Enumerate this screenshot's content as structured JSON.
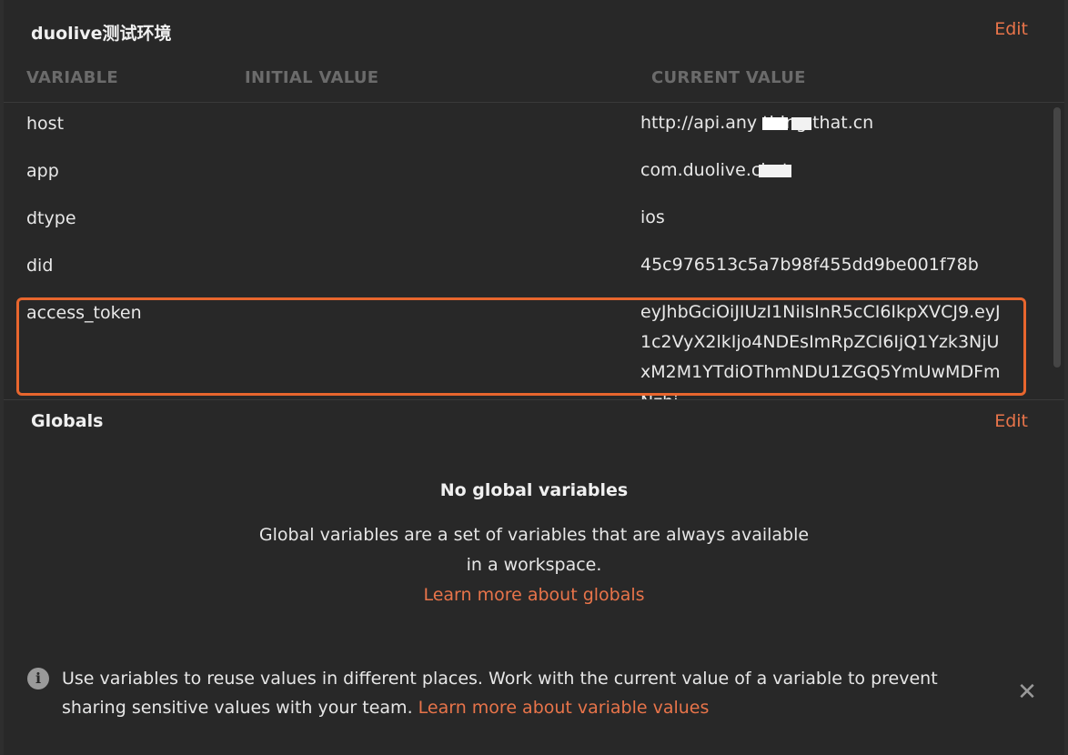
{
  "environment": {
    "title": "duolive测试环境",
    "edit_label": "Edit"
  },
  "columns": {
    "variable": "VARIABLE",
    "initial_value": "INITIAL VALUE",
    "current_value": "CURRENT VALUE"
  },
  "variables": [
    {
      "name": "host",
      "current": "http://api.any thing that.cn"
    },
    {
      "name": "app",
      "current": "com.duolive.chat"
    },
    {
      "name": "dtype",
      "current": "ios"
    },
    {
      "name": "did",
      "current": "45c976513c5a7b98f455dd9be001f78b"
    },
    {
      "name": "access_token",
      "current": "eyJhbGciOiJIUzI1NiIsInR5cCI6IkpXVCJ9.eyJ1c2VyX2lkIjo4NDEsImRpZCI6IjQ1Yzk3NjUxM2M1YTdiOThmNDU1ZGQ5YmUwMDFmNzhi"
    }
  ],
  "globals": {
    "title": "Globals",
    "edit_label": "Edit",
    "empty_title": "No global variables",
    "empty_desc": "Global variables are a set of variables that are always available in a workspace.",
    "learn_more": "Learn more about globals"
  },
  "info": {
    "text": "Use variables to reuse values in different places. Work with the current value of a variable to prevent sharing sensitive values with your team.",
    "link": "Learn more about variable values",
    "icon": "info-icon",
    "close_icon": "close-icon"
  },
  "colors": {
    "accent": "#e8744a",
    "highlight_border": "#e8662e",
    "panel_bg": "#282828"
  }
}
